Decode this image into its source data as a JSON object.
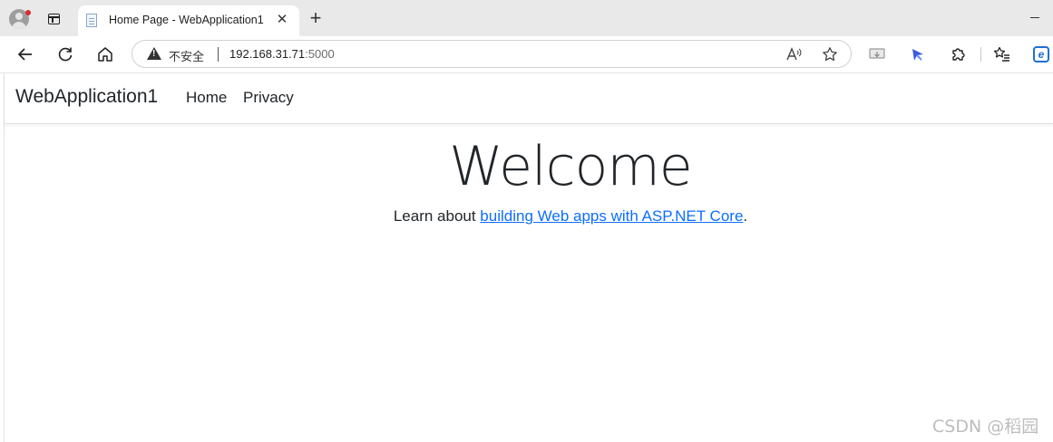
{
  "browser": {
    "tab_title": "Home Page - WebApplication1",
    "tab_close_glyph": "✕",
    "new_tab_glyph": "+",
    "address": {
      "security_label": "不安全",
      "host": "192.168.31.71",
      "port": ":5000"
    },
    "toolbar_icons": [
      "back-arrow-icon",
      "refresh-icon",
      "home-icon",
      "read-aloud-icon",
      "favorite-star-icon",
      "screen-cast-icon",
      "extension-sparkle-icon",
      "extensions-puzzle-icon",
      "favorites-list-icon",
      "edge-icon"
    ]
  },
  "site": {
    "brand": "WebApplication1",
    "nav": {
      "home": "Home",
      "privacy": "Privacy"
    },
    "heading": "Welcome",
    "lead_prefix": "Learn about ",
    "lead_link": "building Web apps with ASP.NET Core",
    "lead_suffix": "."
  },
  "watermark": "CSDN @稻园",
  "colors": {
    "link": "#0d6efd",
    "text": "#212529",
    "tabstrip": "#e9e9e9"
  }
}
